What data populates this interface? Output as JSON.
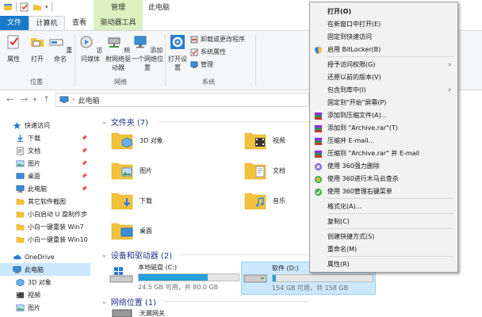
{
  "titlebar": {
    "context_tab_label": "管理",
    "window_title": "此电脑"
  },
  "tabs": {
    "file": "文件",
    "computer": "计算机",
    "view": "查看",
    "drive_tools": "驱动器工具"
  },
  "ribbon": {
    "location": {
      "properties": "属性",
      "open": "打开",
      "rename": "重命名",
      "group": "位置"
    },
    "network": {
      "access_media": "访问媒体",
      "map_drive": "映射网络驱动器",
      "add_location": "添加一个网络位置",
      "group": "网络"
    },
    "system": {
      "open_settings": "打开设置",
      "uninstall": "卸载或更改程序",
      "system_properties": "系统属性",
      "manage": "管理",
      "group": "系统"
    }
  },
  "address": {
    "path": "此电脑"
  },
  "nav": {
    "items": [
      {
        "label": "快速访问",
        "icon": "star-icon",
        "pinned": false
      },
      {
        "label": "下载",
        "icon": "download-icon",
        "pinned": true
      },
      {
        "label": "文档",
        "icon": "document-icon",
        "pinned": true
      },
      {
        "label": "图片",
        "icon": "picture-icon",
        "pinned": true
      },
      {
        "label": "桌面",
        "icon": "desktop-icon",
        "pinned": true
      },
      {
        "label": "此电脑",
        "icon": "computer-icon",
        "pinned": true
      },
      {
        "label": "其它软件截图",
        "icon": "folder-icon",
        "pinned": false
      },
      {
        "label": "小白启动 U 盘制作步",
        "icon": "folder-icon",
        "pinned": false
      },
      {
        "label": "小白一键重装 Win7 ",
        "icon": "folder-icon",
        "pinned": false
      },
      {
        "label": "小白一键重装 Win10",
        "icon": "folder-icon",
        "pinned": false
      },
      {
        "label": "OneDrive",
        "icon": "cloud-icon",
        "pinned": false
      },
      {
        "label": "此电脑",
        "icon": "computer-icon",
        "pinned": false
      },
      {
        "label": "3D 对象",
        "icon": "cube-icon",
        "pinned": false
      },
      {
        "label": "视频",
        "icon": "video-icon",
        "pinned": false
      },
      {
        "label": "图片",
        "icon": "picture-icon",
        "pinned": false
      }
    ]
  },
  "content": {
    "folders_header": "文件夹 (7)",
    "folders": [
      {
        "label": "3D 对象",
        "icon": "cube-folder-icon"
      },
      {
        "label": "视频",
        "icon": "video-folder-icon"
      },
      {
        "label": "图片",
        "icon": "picture-folder-icon"
      },
      {
        "label": "文档",
        "icon": "document-folder-icon"
      },
      {
        "label": "下载",
        "icon": "download-folder-icon"
      },
      {
        "label": "音乐",
        "icon": "music-folder-icon"
      },
      {
        "label": "桌面",
        "icon": "desktop-folder-icon"
      }
    ],
    "drives_header": "设备和驱动器 (2)",
    "drives": [
      {
        "label": "本地磁盘 (C:)",
        "free": "24.5 GB 可用，共 80.0 GB",
        "used_fraction": 0.69
      },
      {
        "label": "软件 (D:)",
        "free": "154 GB 可用，共 158 GB",
        "used_fraction": 0.03
      }
    ],
    "network_header": "网络位置 (1)",
    "network_item": "天翼网关"
  },
  "menu": {
    "items": [
      {
        "label": "打开(O)",
        "bold": true,
        "icon": "",
        "submenu": false
      },
      {
        "label": "在新窗口中打开(E)",
        "bold": false,
        "icon": "",
        "submenu": false
      },
      {
        "label": "固定到快速访问",
        "bold": false,
        "icon": "",
        "submenu": false
      },
      {
        "label": "启用 BitLocker(B)",
        "bold": false,
        "icon": "shield-icon",
        "submenu": false
      },
      {
        "label": "授予访问权限(G)",
        "bold": false,
        "icon": "",
        "submenu": true
      },
      {
        "label": "还原以前的版本(V)",
        "bold": false,
        "icon": "",
        "submenu": false
      },
      {
        "label": "包含到库中(I)",
        "bold": false,
        "icon": "",
        "submenu": true
      },
      {
        "label": "固定到\"开始\"屏幕(P)",
        "bold": false,
        "icon": "",
        "submenu": false
      },
      {
        "label": "添加到压缩文件(A)...",
        "bold": false,
        "icon": "winrar-icon",
        "submenu": false
      },
      {
        "label": "添加到 \"Archive.rar\"(T)",
        "bold": false,
        "icon": "winrar-icon",
        "submenu": false
      },
      {
        "label": "压缩并 E-mail...",
        "bold": false,
        "icon": "winrar-icon",
        "submenu": false
      },
      {
        "label": "压缩到 \"Archive.rar\" 并 E-mail",
        "bold": false,
        "icon": "winrar-icon",
        "submenu": false
      },
      {
        "label": "使用 360强力删除",
        "bold": false,
        "icon": "360-delete-icon",
        "submenu": false
      },
      {
        "label": "使用 360进行木马云查杀",
        "bold": false,
        "icon": "360-scan-icon",
        "submenu": false
      },
      {
        "label": "使用 360管理右键菜单",
        "bold": false,
        "icon": "360-menu-icon",
        "submenu": false
      },
      {
        "label": "格式化(A)...",
        "bold": false,
        "icon": "",
        "submenu": false
      },
      {
        "label": "复制(C)",
        "bold": false,
        "icon": "",
        "submenu": false
      },
      {
        "label": "创建快捷方式(S)",
        "bold": false,
        "icon": "",
        "submenu": false
      },
      {
        "label": "重命名(M)",
        "bold": false,
        "icon": "",
        "submenu": false
      },
      {
        "label": "属性(R)",
        "bold": false,
        "icon": "",
        "submenu": false
      }
    ]
  },
  "colors": {
    "file_tab": "#1979ca",
    "context_tab": "#dcf0c0",
    "selection": "#cce8ff",
    "drive_bar": "#26a0da",
    "section_header": "#1e3287"
  }
}
